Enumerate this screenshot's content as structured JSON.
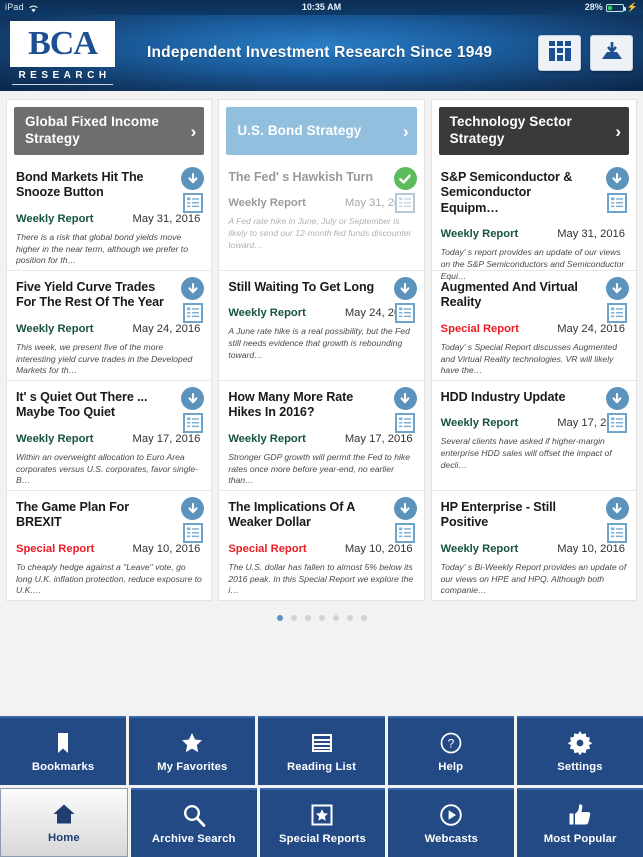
{
  "status_bar": {
    "device": "iPad",
    "wifi_icon": "wifi-icon",
    "time": "10:35 AM",
    "battery_percent": "28%",
    "battery_level": 28,
    "charging_icon": "lightning-bolt-icon"
  },
  "header": {
    "logo_text": "BCA",
    "logo_subtext": "RESEARCH",
    "tagline": "Independent Investment Research Since 1949",
    "actions": [
      {
        "name": "grid-view-button",
        "icon": "grid-icon"
      },
      {
        "name": "downloads-button",
        "icon": "inbox-download-icon"
      }
    ],
    "colors": {
      "bar_blue": "#1b5d9e",
      "logo_blue": "#1d4f93"
    }
  },
  "columns": [
    {
      "title": "Global Fixed Income Strategy",
      "header_color": "#6e6e6e",
      "chevron": "›",
      "cards": [
        {
          "title": "Bond Markets Hit The Snooze Button",
          "type": "Weekly Report",
          "type_style": "weekly",
          "date": "May 31, 2016",
          "desc": "There is a risk that global bond yields move higher in the near term, although we prefer to position for th…",
          "status": "download",
          "read": false
        },
        {
          "title": "Five Yield Curve Trades For The Rest Of The Year",
          "type": "Weekly Report",
          "type_style": "weekly",
          "date": "May 24, 2016",
          "desc": "This week, we present five of the more interesting yield curve trades in the Developed Markets for th…",
          "status": "download",
          "read": false
        },
        {
          "title": "It' s Quiet Out There ... Maybe Too Quiet",
          "type": "Weekly Report",
          "type_style": "weekly",
          "date": "May 17, 2016",
          "desc": "Within an overweight allocation to Euro Area corporates versus U.S. corporates, favor single-B…",
          "status": "download",
          "read": false
        },
        {
          "title": "The Game Plan For BREXIT",
          "type": "Special Report",
          "type_style": "special",
          "date": "May 10, 2016",
          "desc": "To cheaply hedge against a \"Leave\" vote, go long U.K. inflation protection, reduce exposure to U.K.…",
          "status": "download",
          "read": false
        }
      ]
    },
    {
      "title": "U.S. Bond Strategy",
      "header_color": "#92bfdd",
      "chevron": "›",
      "cards": [
        {
          "title": "The Fed' s Hawkish Turn",
          "type": "Weekly Report",
          "type_style": "weekly",
          "date": "May 31, 2016",
          "desc": "A Fed rate hike in June, July or September is likely to send our 12-month fed funds discounter toward…",
          "status": "downloaded",
          "read": true
        },
        {
          "title": "Still Waiting To Get Long",
          "type": "Weekly Report",
          "type_style": "weekly",
          "date": "May 24, 2016",
          "desc": "A June rate hike is a real possibility, but the Fed still needs evidence that growth is rebounding toward…",
          "status": "download",
          "read": false
        },
        {
          "title": "How Many More Rate Hikes In 2016?",
          "type": "Weekly Report",
          "type_style": "weekly",
          "date": "May 17, 2016",
          "desc": "Stronger GDP growth will permit the Fed to hike rates once more before year-end, no earlier than…",
          "status": "download",
          "read": false
        },
        {
          "title": "The Implications Of A Weaker Dollar",
          "type": "Special Report",
          "type_style": "special",
          "date": "May 10, 2016",
          "desc": "The U.S. dollar has fallen to almost 5% below its 2016 peak. In this Special Report we explore the i…",
          "status": "download",
          "read": false
        }
      ]
    },
    {
      "title": "Technology Sector Strategy",
      "header_color": "#3a3a3a",
      "chevron": "›",
      "cards": [
        {
          "title": "S&P Semiconductor & Semiconductor Equipm…",
          "type": "Weekly Report",
          "type_style": "weekly",
          "date": "May 31, 2016",
          "desc": "Today' s report provides an update of our views on the S&P Semiconductors and Semiconductor Equi…",
          "status": "download",
          "read": false
        },
        {
          "title": "Augmented And Virtual Reality",
          "type": "Special Report",
          "type_style": "special",
          "date": "May 24, 2016",
          "desc": "Today' s Special Report discusses Augmented and Virtual Reality technologies. VR will likely have the…",
          "status": "download",
          "read": false
        },
        {
          "title": "HDD Industry Update",
          "type": "Weekly Report",
          "type_style": "weekly",
          "date": "May 17, 2016",
          "desc": "Several clients have asked if higher-margin enterprise HDD sales will offset the impact of decli…",
          "status": "download",
          "read": false
        },
        {
          "title": "HP Enterprise - Still Positive",
          "type": "Weekly Report",
          "type_style": "weekly",
          "date": "May 10, 2016",
          "desc": "Today' s Bi-Weekly Report provides an update of our views on HPE and HPQ. Although both companie…",
          "status": "download",
          "read": false
        }
      ]
    }
  ],
  "pager": {
    "total": 7,
    "active_index": 0
  },
  "tabbar": {
    "rows": [
      [
        {
          "label": "Bookmarks",
          "icon": "bookmark-icon",
          "selected": false
        },
        {
          "label": "My Favorites",
          "icon": "star-icon",
          "selected": false
        },
        {
          "label": "Reading List",
          "icon": "list-icon",
          "selected": false
        },
        {
          "label": "Help",
          "icon": "question-circle-icon",
          "selected": false
        },
        {
          "label": "Settings",
          "icon": "gear-icon",
          "selected": false
        }
      ],
      [
        {
          "label": "Home",
          "icon": "home-icon",
          "selected": true
        },
        {
          "label": "Archive Search",
          "icon": "search-icon",
          "selected": false
        },
        {
          "label": "Special Reports",
          "icon": "star-box-icon",
          "selected": false
        },
        {
          "label": "Webcasts",
          "icon": "play-circle-icon",
          "selected": false
        },
        {
          "label": "Most Popular",
          "icon": "thumbs-up-icon",
          "selected": false
        }
      ]
    ],
    "colors": {
      "tile_blue": "#234a85",
      "selected_text": "#1f3f72"
    }
  }
}
